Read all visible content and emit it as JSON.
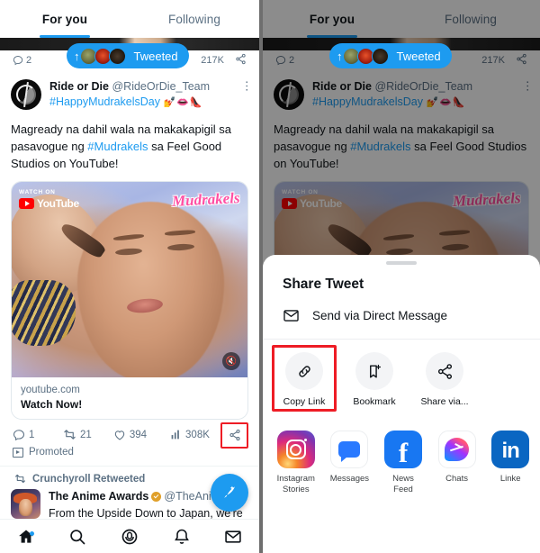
{
  "app": {
    "name": "Twitter",
    "accent_color": "#1d9bf0",
    "highlight_color": "#ee1c25",
    "text_primary": "#0f1419",
    "text_secondary": "#5b7083"
  },
  "left_panel": {
    "tabs": [
      {
        "label": "For you",
        "active": true
      },
      {
        "label": "Following",
        "active": false
      }
    ],
    "previous_tweet": {
      "reply_count": "2",
      "view_count": "217K",
      "share_icon": "share-icon"
    },
    "tweeted_pill": {
      "label": "Tweeted",
      "arrow_icon": "arrow-up-icon",
      "avatar_count": 3
    },
    "tweet": {
      "author_name": "Ride or Die",
      "author_handle": "@RideOrDie_Team",
      "hashtag_line": "#HappyMudrakelsDay",
      "hashtag_emojis": "💅👄👠",
      "body_part1": "Magready na dahil wala na makakapigil sa pasavogue ng ",
      "body_link": "#Mudrakels",
      "body_part2": " sa Feel Good Studios on YouTube!",
      "more_icon": "more-options-icon",
      "card": {
        "watch_on_label": "WATCH ON",
        "youtube_label": "YouTube",
        "brand_overlay": "Mudrakels",
        "mute_icon": "mute-icon",
        "domain": "youtube.com",
        "title": "Watch Now!"
      },
      "actions": {
        "reply_count": "1",
        "retweet_count": "21",
        "like_count": "394",
        "view_count": "308K",
        "share_icon": "share-icon",
        "share_highlighted": true
      },
      "promoted_label": "Promoted"
    },
    "next_tweet": {
      "retweet_context": "Crunchyroll Retweeted",
      "author_name": "The Anime Awards",
      "author_handle": "@TheAnim...",
      "verified": true,
      "body": "From the Upside Down to Japan, we're"
    },
    "compose_fab": "compose-tweet-button",
    "bottom_nav": [
      {
        "icon": "home-icon",
        "label": "Home",
        "active": true,
        "badge": true
      },
      {
        "icon": "search-icon",
        "label": "Search",
        "active": false,
        "badge": false
      },
      {
        "icon": "spaces-icon",
        "label": "Spaces",
        "active": false,
        "badge": false
      },
      {
        "icon": "notifications-bell-icon",
        "label": "Notifications",
        "active": false,
        "badge": false
      },
      {
        "icon": "messages-envelope-icon",
        "label": "Messages",
        "active": false,
        "badge": false
      }
    ]
  },
  "right_panel": {
    "dimmed_background": true,
    "share_sheet": {
      "grabber": "sheet-grab-handle",
      "title": "Share Tweet",
      "direct_message": {
        "icon": "envelope-icon",
        "label": "Send via Direct Message"
      },
      "quick_actions": [
        {
          "icon": "link-icon",
          "label": "Copy Link",
          "highlighted": true
        },
        {
          "icon": "bookmark-add-icon",
          "label": "Bookmark",
          "highlighted": false
        },
        {
          "icon": "share-icon",
          "label": "Share via...",
          "highlighted": false
        }
      ],
      "apps": [
        {
          "icon": "instagram-icon",
          "label": "Instagram Stories"
        },
        {
          "icon": "messages-icon",
          "label": "Messages"
        },
        {
          "icon": "facebook-icon",
          "label": "News Feed"
        },
        {
          "icon": "messenger-icon",
          "label": "Chats"
        },
        {
          "icon": "linkedin-icon",
          "label": "Linke"
        }
      ]
    }
  }
}
